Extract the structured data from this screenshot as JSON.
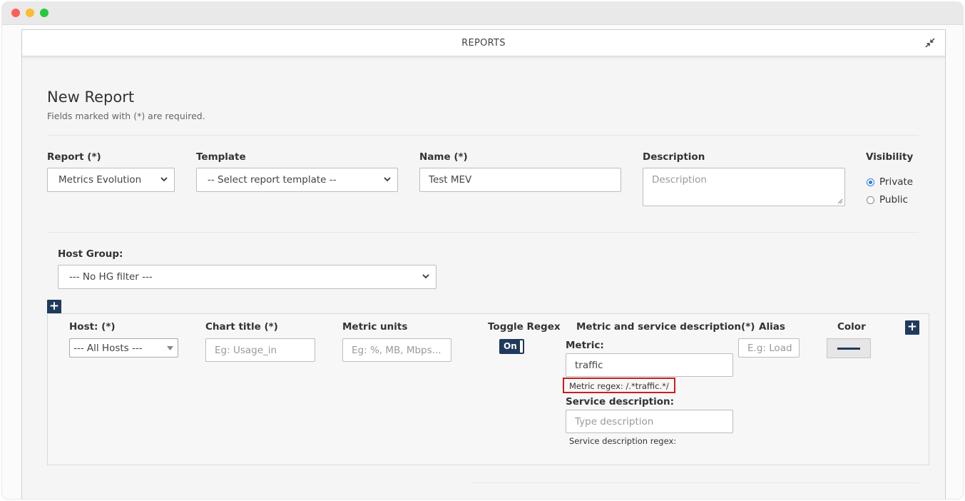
{
  "modal": {
    "title": "REPORTS"
  },
  "header": {
    "title": "New Report",
    "subtitle": "Fields marked with (*) are required."
  },
  "form": {
    "report": {
      "label": "Report (*)",
      "value": "Metrics Evolution"
    },
    "template": {
      "label": "Template",
      "value": "-- Select report template --"
    },
    "name": {
      "label": "Name (*)",
      "value": "Test MEV"
    },
    "description": {
      "label": "Description",
      "placeholder": "Description"
    },
    "visibility": {
      "label": "Visibility",
      "options": [
        "Private",
        "Public"
      ],
      "selected": "Private"
    },
    "host_group": {
      "label": "Host Group:",
      "value": "--- No HG filter ---"
    }
  },
  "metrics_row": {
    "host": {
      "label": "Host: (*)",
      "value": "--- All Hosts ---"
    },
    "chart_title": {
      "label": "Chart title (*)",
      "placeholder": "Eg: Usage_in"
    },
    "metric_units": {
      "label": "Metric units",
      "placeholder": "Eg: %, MB, Mbps..."
    },
    "toggle_regex": {
      "label": "Toggle Regex",
      "state": "On"
    },
    "metric_service": {
      "label": "Metric and service description(*)",
      "metric_label": "Metric:",
      "metric_value": "traffic",
      "metric_regex": "Metric regex: /.*traffic.*/",
      "service_label": "Service description:",
      "service_placeholder": "Type description",
      "service_regex": "Service description regex:"
    },
    "alias": {
      "label": "Alias",
      "placeholder": "E.g: Load"
    },
    "color": {
      "label": "Color",
      "value": "#1f3a5c"
    }
  },
  "icons": {
    "add": "+",
    "collapse": "collapse-icon"
  }
}
